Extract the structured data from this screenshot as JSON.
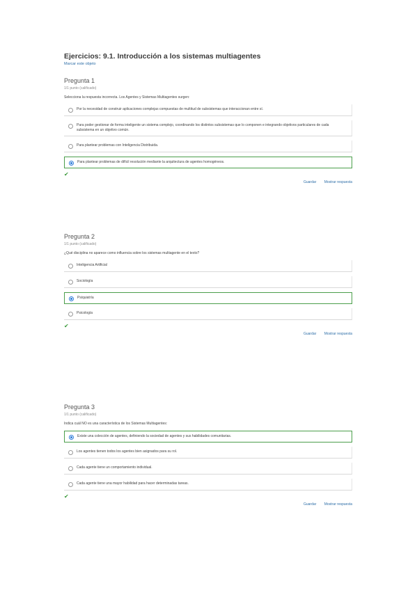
{
  "page": {
    "title": "Ejercicios: 9.1. Introducción a los sistemas multiagentes",
    "bookmark": "Marcar este objeto"
  },
  "questions": [
    {
      "title": "Pregunta 1",
      "status": "1/1 punto (calificado)",
      "prompt": "Selecciona la respuesta incorrecta. Los Agentes y Sistemas Multiagentes surgen:",
      "options": [
        {
          "text": "Por la necesidad de construir aplicaciones complejas compuestas de multitud de subsistemas que interaccionan entre sí.",
          "selected": false,
          "correct": false
        },
        {
          "text": "Para poder gestionar de forma inteligente un sistema complejo, coordinando los distintos subsistemas que lo componen e integrando objetivos particulares de cada subsistema en un objetivo común.",
          "selected": false,
          "correct": false
        },
        {
          "text": "Para plantear problemas con Inteligencia Distribuida.",
          "selected": false,
          "correct": false
        },
        {
          "text": "Para plantear problemas de difícil resolución mediante la arquitectura de agentes homogéneos.",
          "selected": true,
          "correct": true
        }
      ],
      "actions": {
        "save": "Guardar",
        "show_answer": "Mostrar respuesta"
      }
    },
    {
      "title": "Pregunta 2",
      "status": "1/1 punto (calificado)",
      "prompt": "¿Qué disciplina no aparece como influencia sobre los sistemas multiagente en el texto?",
      "options": [
        {
          "text": "Inteligencia Artificial",
          "selected": false,
          "correct": false
        },
        {
          "text": "Sociología",
          "selected": false,
          "correct": false
        },
        {
          "text": "Psiquiatría",
          "selected": true,
          "correct": true
        },
        {
          "text": "Psicología",
          "selected": false,
          "correct": false
        }
      ],
      "actions": {
        "save": "Guardar",
        "show_answer": "Mostrar respuesta"
      }
    },
    {
      "title": "Pregunta 3",
      "status": "1/1 punto (calificado)",
      "prompt": "Indica cuál NO es una característica de los Sistemas Multiagentes:",
      "options": [
        {
          "text": "Existe una colección de agentes, definiendo la sociedad de agentes y sus habilidades comunitarias.",
          "selected": true,
          "correct": true
        },
        {
          "text": "Los agentes tienen todos los agentes bien asignados para su rol.",
          "selected": false,
          "correct": false
        },
        {
          "text": "Cada agente tiene un comportamiento individual.",
          "selected": false,
          "correct": false
        },
        {
          "text": "Cada agente tiene una mayor habilidad para hacer determinadas tareas.",
          "selected": false,
          "correct": false
        }
      ],
      "actions": {
        "save": "Guardar",
        "show_answer": "Mostrar respuesta"
      }
    }
  ],
  "colors": {
    "accent": "#2f6fa8",
    "correct_border": "#4a9e4a",
    "check": "#3a9a3a",
    "radio_checked": "#2a7ad8"
  },
  "icons": {
    "correct": "check-icon",
    "radio": "radio-icon"
  }
}
